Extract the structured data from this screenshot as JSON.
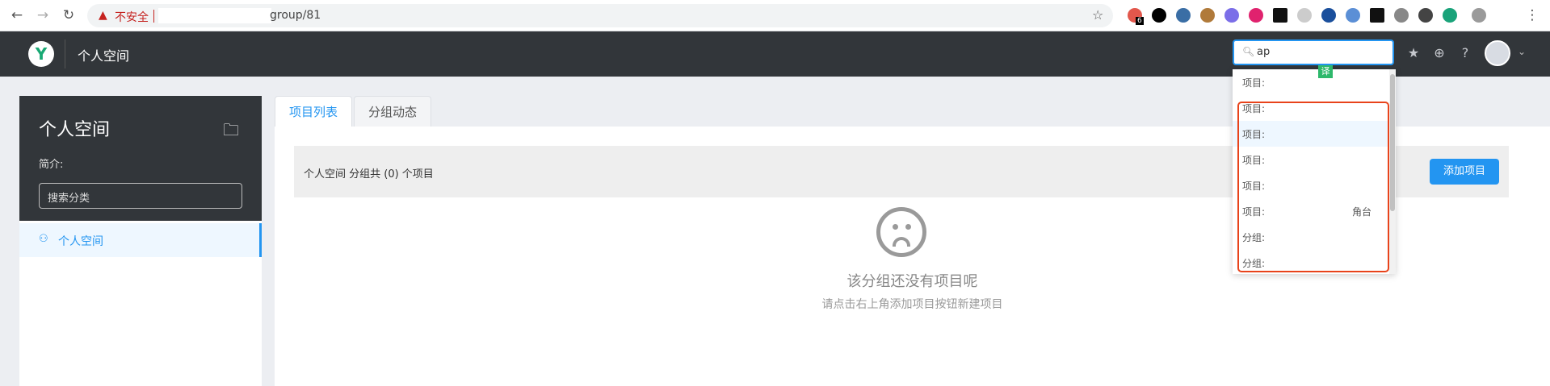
{
  "browser": {
    "insecure_label": "不安全",
    "url_path": "group/81",
    "ext_badge": "6"
  },
  "header": {
    "logo_letter": "Y",
    "title": "个人空间",
    "search_value": "ap",
    "translate_label": "译"
  },
  "sidebar": {
    "title": "个人空间",
    "intro_label": "简介:",
    "search_placeholder": "搜索分类",
    "groups": [
      {
        "label": "个人空间"
      }
    ]
  },
  "tabs": [
    {
      "label": "项目列表",
      "active": true
    },
    {
      "label": "分组动态",
      "active": false
    }
  ],
  "summary": {
    "text": "个人空间 分组共 (0) 个项目",
    "add_button": "添加项目"
  },
  "empty_state": {
    "title": "该分组还没有项目呢",
    "subtitle": "请点击右上角添加项目按钮新建项目"
  },
  "search_dropdown": {
    "items": [
      {
        "label": "项目:",
        "rest": ""
      },
      {
        "label": "项目:",
        "rest": ""
      },
      {
        "label": "项目:",
        "rest": ""
      },
      {
        "label": "项目:",
        "rest": ""
      },
      {
        "label": "项目:",
        "rest": ""
      },
      {
        "label": "项目:",
        "rest": "⻆台"
      },
      {
        "label": "分组:",
        "rest": ""
      },
      {
        "label": "分组:",
        "rest": ""
      }
    ]
  },
  "colors": {
    "accent": "#2395f1",
    "header_bg": "#32363a",
    "highlight_border": "#e8431b"
  }
}
